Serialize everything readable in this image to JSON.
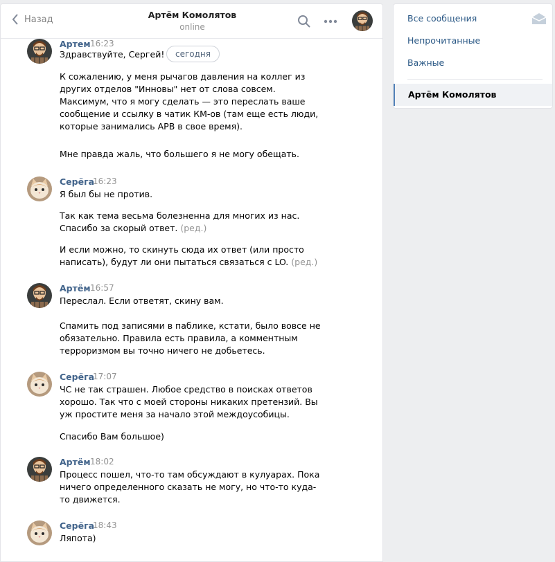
{
  "header": {
    "back_label": "Назад",
    "peer_name": "Артём Комолятов",
    "peer_status": "online"
  },
  "date_pill": "сегодня",
  "messages": [
    {
      "author": "Артем",
      "time": "16:23",
      "avatar": "artem",
      "paragraphs": [
        "Здравствуйте, Сергей!",
        "К сожалению, у меня рычагов давления на коллег из других отделов \"Инновы\" нет от слова совсем. Максимум, что я могу сделать — это переслать ваше сообщение и ссылку в чатик КМ-ов (там еще есть люди, которые занимались АРВ в свое время).",
        "Мне правда жаль, что большего я не могу обещать."
      ]
    },
    {
      "author": "Серёга",
      "time": "16:23",
      "avatar": "cat",
      "paragraphs": [
        "Я был бы не против.",
        "Так как тема весьма болезненна для многих из нас. Спасибо за скорый ответ.",
        "И если можно, то скинуть сюда их ответ (или просто написать), будут ли они пытаться связаться с LO."
      ],
      "edited_label": "(ред.)"
    },
    {
      "author": "Артём",
      "time": "16:57",
      "avatar": "artem",
      "paragraphs": [
        "Переслал. Если ответят, скину вам.",
        "Спамить под записями в паблике, кстати, было вовсе не обязательно. Правила есть правила, а комментным терроризмом вы точно ничего не добьетесь."
      ]
    },
    {
      "author": "Серёга",
      "time": "17:07",
      "avatar": "cat",
      "paragraphs": [
        "ЧС не так страшен. Любое средство в поисках ответов хорошо. Так что с моей стороны никаких претензий. Вы уж простите меня за начало этой междоусобицы.",
        "Спасибо Вам большое)"
      ]
    },
    {
      "author": "Артём",
      "time": "18:02",
      "avatar": "artem",
      "paragraphs": [
        "Процесс пошел, что-то там обсуждают в кулуарах. Пока ничего определенного сказать не могу, но что-то куда-то движется."
      ]
    },
    {
      "author": "Серёга",
      "time": "18:43",
      "avatar": "cat",
      "paragraphs": [
        "Ляпота)"
      ]
    }
  ],
  "right_nav": {
    "items": [
      "Все сообщения",
      "Непрочитанные",
      "Важные"
    ],
    "active_conversation": "Артём Комолятов"
  },
  "colors": {
    "accent": "#5181b8",
    "author": "#42648b",
    "link": "#2a5885",
    "muted": "#939393"
  }
}
